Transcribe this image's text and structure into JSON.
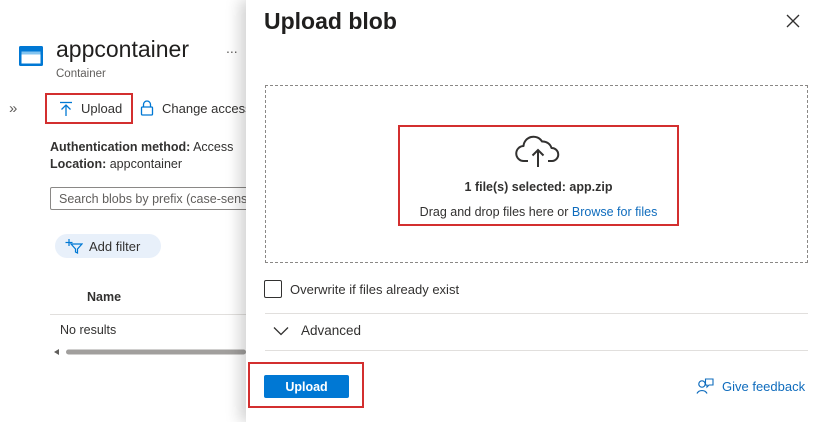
{
  "background": {
    "title": "appcontainer",
    "subtitle": "Container",
    "more": "...",
    "collapse_glyph": "»",
    "toolbar": {
      "upload_label": "Upload",
      "change_access_label": "Change access"
    },
    "info": {
      "auth_label": "Authentication method:",
      "auth_value": "Access",
      "location_label": "Location:",
      "location_value": "appcontainer"
    },
    "search_placeholder": "Search blobs by prefix (case-sensitive)",
    "add_filter_label": "Add filter",
    "table": {
      "columns": [
        "Name"
      ],
      "empty_text": "No results"
    }
  },
  "panel": {
    "title": "Upload blob",
    "dropzone": {
      "selected_text": "1 file(s) selected: app.zip",
      "drag_text": "Drag and drop files here",
      "or_text": "or",
      "browse_label": "Browse for files"
    },
    "overwrite_label": "Overwrite if files already exist",
    "overwrite_checked": false,
    "advanced_label": "Advanced",
    "upload_button": "Upload",
    "feedback_label": "Give feedback"
  },
  "icons": {
    "container": "container-icon",
    "upload": "upload-arrow-icon",
    "lock": "lock-icon",
    "filter": "add-filter-icon",
    "cloud": "cloud-upload-icon",
    "close": "close-icon",
    "chevron": "chevron-down-icon",
    "feedback": "feedback-icon"
  },
  "colors": {
    "accent": "#0078d4",
    "link": "#0f6cbd",
    "highlight": "#d32f2f"
  }
}
